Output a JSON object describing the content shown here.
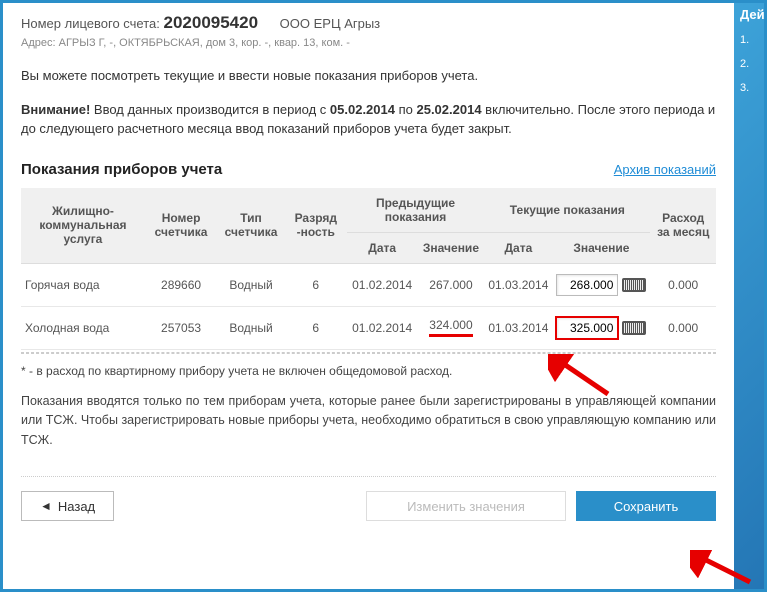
{
  "account": {
    "label": "Номер лицевого счета:",
    "number": "2020095420",
    "org": "ООО ЕРЦ Агрыз",
    "addr_label": "Адрес:",
    "address": "АГРЫЗ Г, -, ОКТЯБРЬСКАЯ, дом 3, кор. -, квар. 13, ком. -"
  },
  "intro": "Вы можете посмотреть текущие и ввести новые показания приборов учета.",
  "notice": {
    "prefix": "Внимание!",
    "p1": " Ввод данных производится в период с ",
    "d1": "05.02.2014",
    "p2": " по ",
    "d2": "25.02.2014",
    "p3": " включительно. После этого периода и до следующего расчетного месяца ввод показаний приборов учета будет закрыт."
  },
  "section": {
    "title": "Показания приборов учета",
    "archive": "Архив показаний"
  },
  "table": {
    "h_service": "Жилищно-коммунальная услуга",
    "h_meter_no": "Номер счетчика",
    "h_meter_type": "Тип счетчика",
    "h_digits": "Разряд -ность",
    "h_prev": "Предыдущие показания",
    "h_curr": "Текущие показания",
    "h_cons": "Расход за месяц",
    "h_date": "Дата",
    "h_value": "Значение",
    "rows": [
      {
        "service": "Горячая вода",
        "meter_no": "289660",
        "meter_type": "Водный",
        "digits": "6",
        "prev_date": "01.02.2014",
        "prev_val": "267.000",
        "curr_date": "01.03.2014",
        "curr_val": "268.000",
        "cons": "0.000",
        "highlight_input": false,
        "highlight_prev": false
      },
      {
        "service": "Холодная вода",
        "meter_no": "257053",
        "meter_type": "Водный",
        "digits": "6",
        "prev_date": "01.02.2014",
        "prev_val": "324.000",
        "curr_date": "01.03.2014",
        "curr_val": "325.000",
        "cons": "0.000",
        "highlight_input": true,
        "highlight_prev": true
      }
    ]
  },
  "footnote": "* - в расход по квартирному прибору учета не включен общедомовой расход.",
  "info": "Показания вводятся только по тем приборам учета, которые ранее были зарегистрированы в управляющей компании или ТСЖ. Чтобы зарегистрировать новые приборы учета, необходимо обратиться в свою управляющую компанию или ТСЖ.",
  "buttons": {
    "back": "Назад",
    "edit": "Изменить значения",
    "save": "Сохранить"
  },
  "sidebar": {
    "heading": "Дей",
    "items": [
      "1.",
      "2.",
      "3."
    ]
  }
}
